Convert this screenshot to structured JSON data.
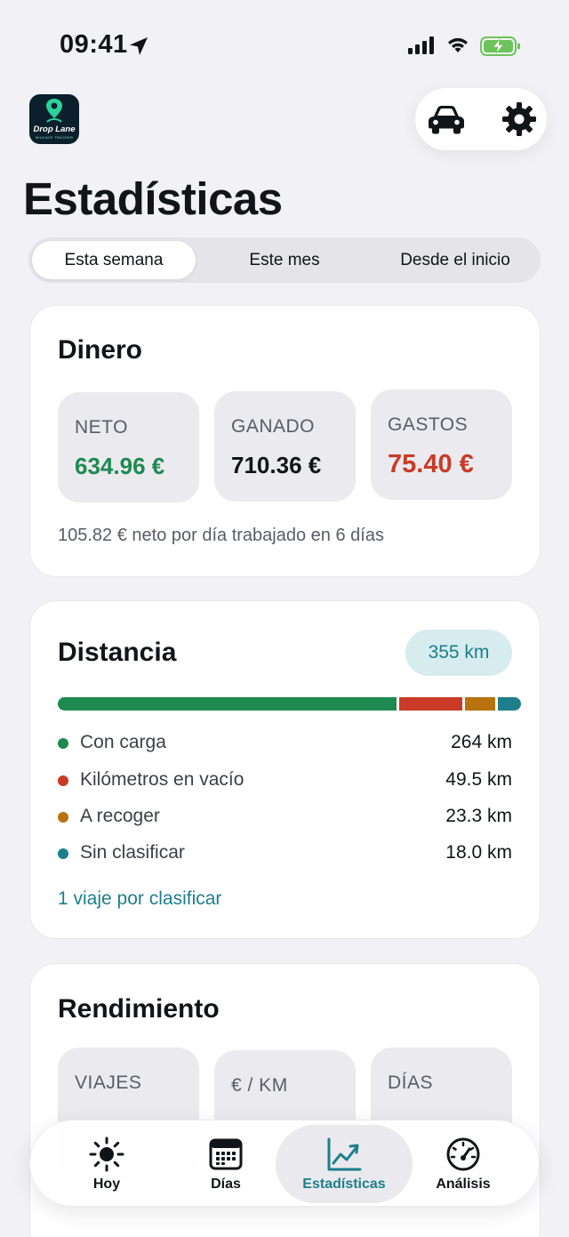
{
  "status_bar": {
    "time": "09:41"
  },
  "app": {
    "logo_name": "Drop Lane",
    "logo_tagline": "MILEAGE TRACKER",
    "icons": {
      "car": "car-icon",
      "settings": "gear-icon"
    }
  },
  "page": {
    "title": "Estadísticas"
  },
  "segmented": {
    "options": [
      "Esta semana",
      "Este mes",
      "Desde el inicio"
    ],
    "selected": "Esta semana"
  },
  "money": {
    "title": "Dinero",
    "tiles": [
      {
        "label": "NETO",
        "value": "634.96 €",
        "color": "#1e8a50"
      },
      {
        "label": "GANADO",
        "value": "710.36 €",
        "color": "#111418"
      },
      {
        "label": "GASTOS",
        "value": "75.40 €",
        "color": "#c93b26"
      }
    ],
    "note": "105.82 € neto por día trabajado en 6 días"
  },
  "distance": {
    "title": "Distancia",
    "total": "355 km",
    "rows": [
      {
        "label": "Con carga",
        "value": "264 km",
        "km": 264,
        "color": "#1e8a50"
      },
      {
        "label": "Kilómetros en vacío",
        "value": "49.5 km",
        "km": 49.5,
        "color": "#c93b26"
      },
      {
        "label": "A recoger",
        "value": "23.3 km",
        "km": 23.3,
        "color": "#b8730f"
      },
      {
        "label": "Sin clasificar",
        "value": "18.0 km",
        "km": 18.0,
        "color": "#1e7e8c"
      }
    ],
    "link": "1 viaje por clasificar"
  },
  "performance": {
    "title": "Rendimiento",
    "tiles": [
      {
        "label": "VIAJES"
      },
      {
        "label": "€ / KM"
      },
      {
        "label": "DÍAS"
      }
    ]
  },
  "nav": {
    "items": [
      {
        "label": "Hoy",
        "icon": "sun-icon"
      },
      {
        "label": "Días",
        "icon": "calendar-icon"
      },
      {
        "label": "Estadísticas",
        "icon": "chart-icon",
        "active": true
      },
      {
        "label": "Análisis",
        "icon": "speedometer-icon"
      }
    ]
  },
  "colors": {
    "accent": "#1e7e8c",
    "positive": "#1e8a50",
    "negative": "#c93b26"
  }
}
